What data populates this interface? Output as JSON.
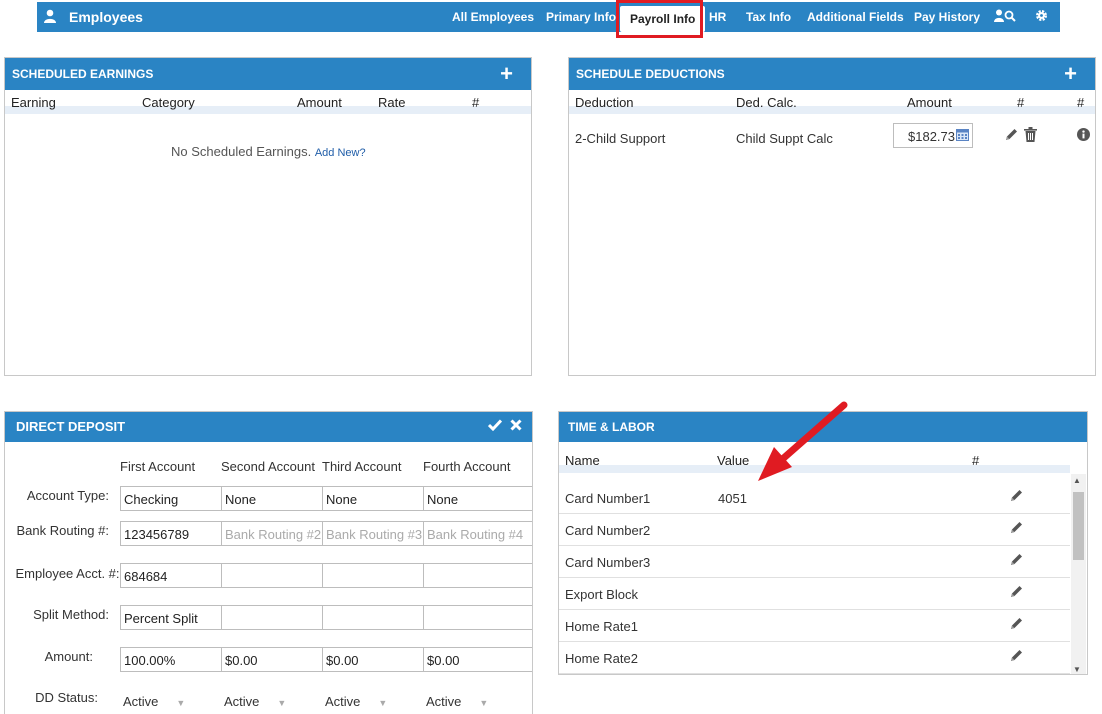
{
  "nav": {
    "title": "Employees",
    "tabs": [
      "All Employees",
      "Primary Info",
      "Payroll Info",
      "HR",
      "Tax Info",
      "Additional Fields",
      "Pay History"
    ],
    "active_tab": "Payroll Info"
  },
  "scheduled_earnings": {
    "title": "SCHEDULED EARNINGS",
    "columns": [
      "Earning",
      "Category",
      "Amount",
      "Rate",
      "#"
    ],
    "empty_text": "No Scheduled Earnings.",
    "add_link": "Add New?"
  },
  "schedule_deductions": {
    "title": "SCHEDULE DEDUCTIONS",
    "columns": [
      "Deduction",
      "Ded. Calc.",
      "Amount",
      "#",
      "#"
    ],
    "rows": [
      {
        "deduction": "2-Child Support",
        "calc": "Child Suppt Calc",
        "amount": "$182.73"
      }
    ]
  },
  "direct_deposit": {
    "title": "DIRECT DEPOSIT",
    "accounts": [
      "First Account",
      "Second Account",
      "Third Account",
      "Fourth Account"
    ],
    "labels": {
      "account_type": "Account Type:",
      "bank_routing": "Bank Routing #:",
      "employee_acct": "Employee Acct. #:",
      "split_method": "Split Method:",
      "amount": "Amount:",
      "dd_status": "DD Status:"
    },
    "account_type": [
      "Checking",
      "None",
      "None",
      "None"
    ],
    "bank_routing": {
      "values": [
        "123456789"
      ],
      "placeholders": [
        "Bank Routing #2",
        "Bank Routing #3",
        "Bank Routing #4"
      ]
    },
    "employee_acct": [
      "684684",
      "",
      "",
      ""
    ],
    "split_method": [
      "Percent Split",
      "",
      "",
      ""
    ],
    "amount": [
      "100.00%",
      "$0.00",
      "$0.00",
      "$0.00"
    ],
    "dd_status": [
      "Active",
      "Active",
      "Active",
      "Active"
    ]
  },
  "time_labor": {
    "title": "TIME & LABOR",
    "columns": [
      "Name",
      "Value",
      "#"
    ],
    "rows": [
      {
        "name": "Card Number1",
        "value": "4051"
      },
      {
        "name": "Card Number2",
        "value": ""
      },
      {
        "name": "Card Number3",
        "value": ""
      },
      {
        "name": "Export Block",
        "value": ""
      },
      {
        "name": "Home Rate1",
        "value": ""
      },
      {
        "name": "Home Rate2",
        "value": ""
      }
    ]
  },
  "colors": {
    "header_blue": "#2a84c4",
    "highlight_red": "#e01b22",
    "arrow_red": "#e01b22"
  }
}
